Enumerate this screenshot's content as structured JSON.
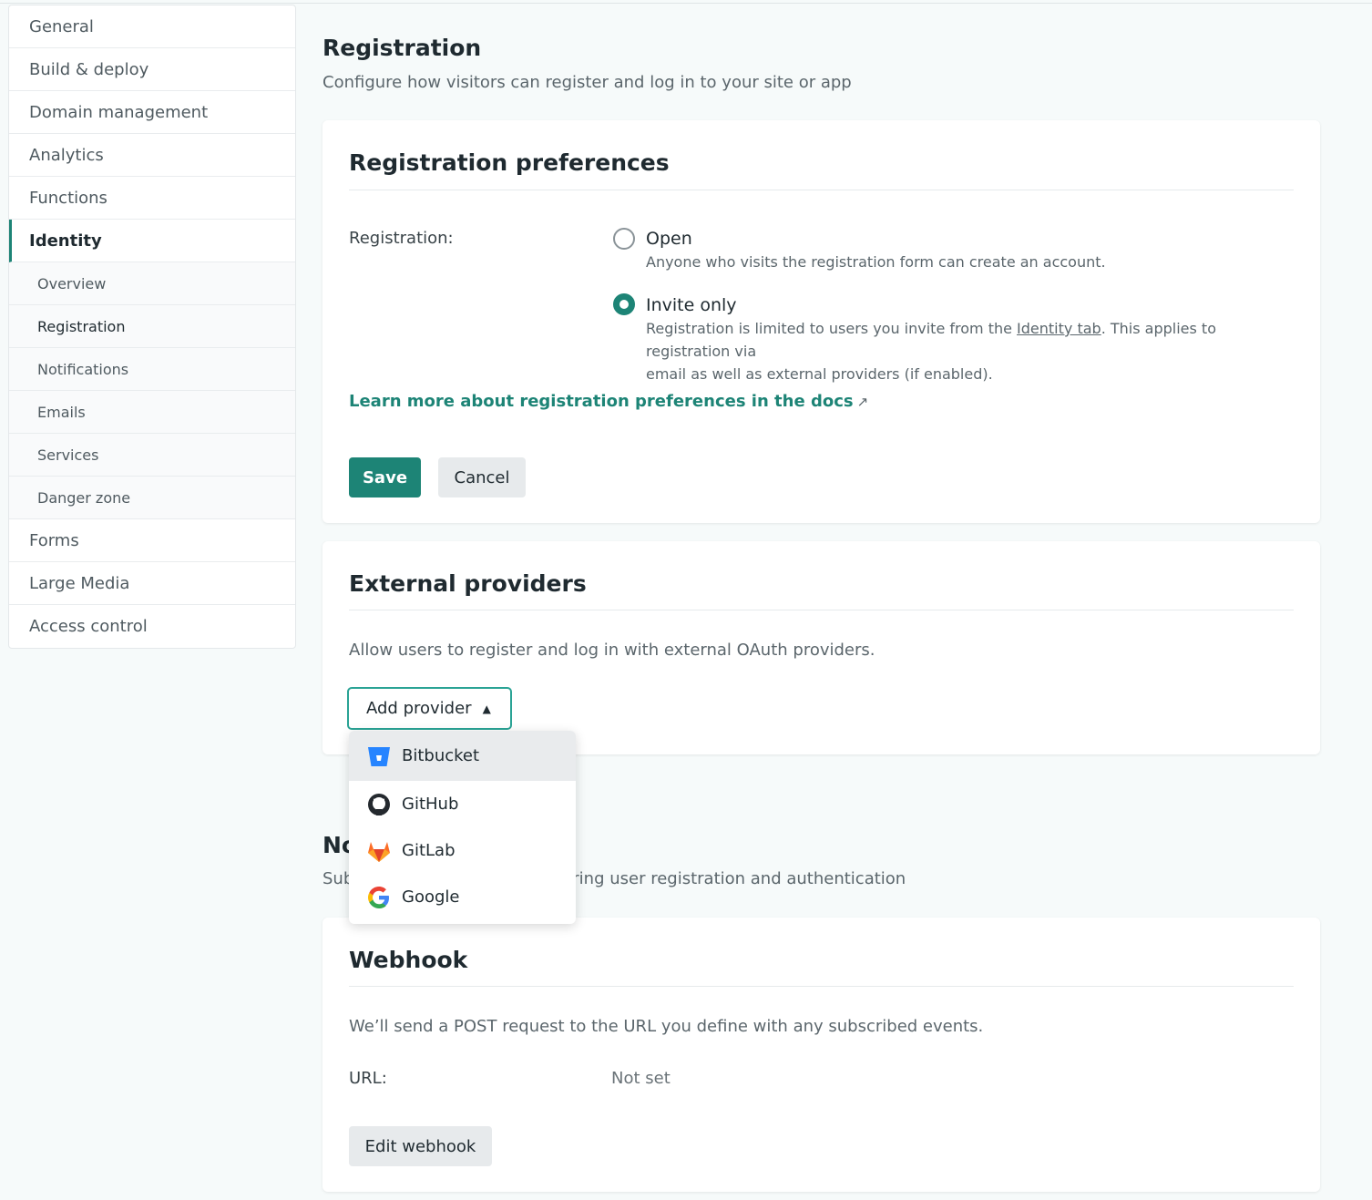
{
  "sidebar": {
    "items": [
      {
        "label": "General"
      },
      {
        "label": "Build & deploy"
      },
      {
        "label": "Domain management"
      },
      {
        "label": "Analytics"
      },
      {
        "label": "Functions"
      },
      {
        "label": "Identity"
      }
    ],
    "sub_items": [
      {
        "label": "Overview"
      },
      {
        "label": "Registration"
      },
      {
        "label": "Notifications"
      },
      {
        "label": "Emails"
      },
      {
        "label": "Services"
      },
      {
        "label": "Danger zone"
      }
    ],
    "items_after": [
      {
        "label": "Forms"
      },
      {
        "label": "Large Media"
      },
      {
        "label": "Access control"
      }
    ]
  },
  "page": {
    "title": "Registration",
    "subtitle": "Configure how visitors can register and log in to your site or app"
  },
  "prefs": {
    "title": "Registration preferences",
    "label": "Registration:",
    "open_label": "Open",
    "open_desc": "Anyone who visits the registration form can create an account.",
    "invite_label": "Invite only",
    "invite_desc_1": "Registration is limited to users you invite from the ",
    "invite_link": "Identity tab",
    "invite_desc_2": ". This applies to registration via",
    "invite_desc_3": "email as well as external providers (if enabled).",
    "selected": "Invite only",
    "docs_link": "Learn more about registration preferences in the docs",
    "docs_arrow": "↗",
    "save": "Save",
    "cancel": "Cancel"
  },
  "external": {
    "title": "External providers",
    "desc": "Allow users to register and log in with external OAuth providers.",
    "add_button": "Add provider",
    "providers": [
      {
        "name": "Bitbucket",
        "icon": "bitbucket-icon"
      },
      {
        "name": "GitHub",
        "icon": "github-icon"
      },
      {
        "name": "GitLab",
        "icon": "gitlab-icon"
      },
      {
        "name": "Google",
        "icon": "google-icon"
      }
    ]
  },
  "notifications": {
    "title": "No",
    "subtitle_left": "Sub",
    "subtitle_right": "ring user registration and authentication"
  },
  "webhook": {
    "title": "Webhook",
    "desc": "We’ll send a POST request to the URL you define with any subscribed events.",
    "url_label": "URL:",
    "url_value": "Not set",
    "edit_button": "Edit webhook"
  },
  "colors": {
    "accent": "#1d8476",
    "background": "#f6fafa"
  }
}
